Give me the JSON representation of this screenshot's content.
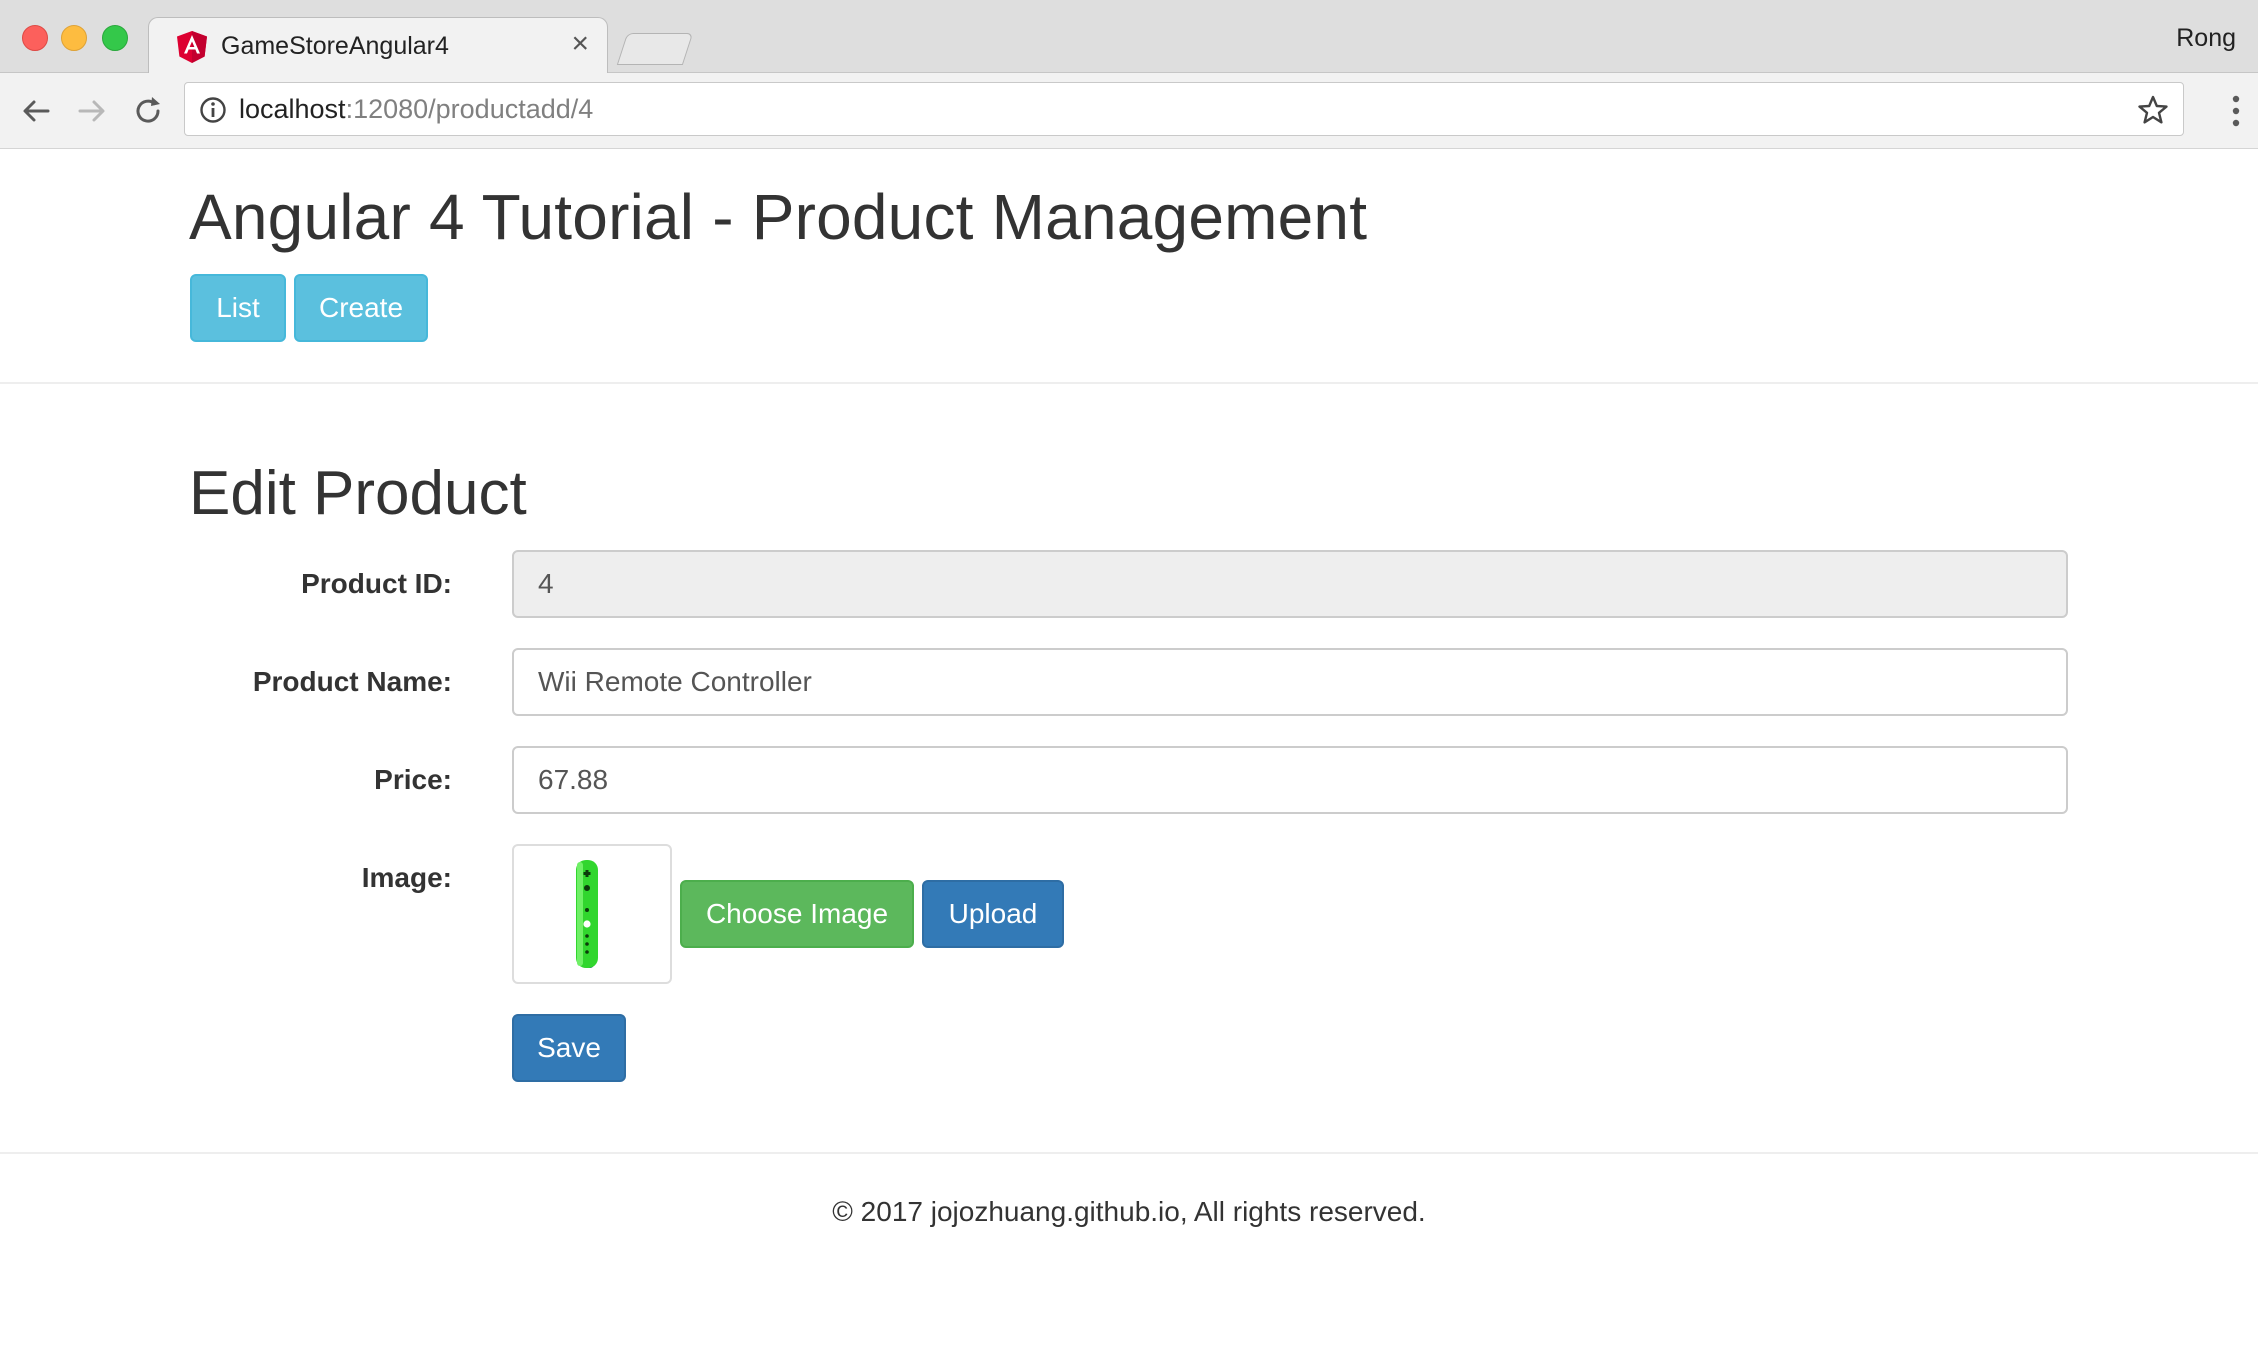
{
  "browser": {
    "tab_title": "GameStoreAngular4",
    "tab_close": "×",
    "profile_name": "Rong",
    "url_host": "localhost",
    "url_rest": ":12080/productadd/4"
  },
  "header": {
    "title": "Angular 4 Tutorial - Product Management",
    "list_label": "List",
    "create_label": "Create"
  },
  "form": {
    "heading": "Edit Product",
    "product_id_label": "Product ID:",
    "product_id_value": "4",
    "product_name_label": "Product Name:",
    "product_name_value": "Wii Remote Controller",
    "price_label": "Price:",
    "price_value": "67.88",
    "image_label": "Image:",
    "choose_image_label": "Choose Image",
    "upload_label": "Upload",
    "save_label": "Save"
  },
  "footer": {
    "copyright": "© 2017 jojozhuang.github.io, All rights reserved."
  },
  "colors": {
    "info": "#5bc0de",
    "success": "#5cb85c",
    "primary": "#337ab7"
  },
  "icons": [
    "angular-favicon-icon",
    "back-arrow-icon",
    "forward-arrow-icon",
    "reload-icon",
    "info-icon",
    "star-icon",
    "menu-dots-icon",
    "wii-remote-image"
  ]
}
